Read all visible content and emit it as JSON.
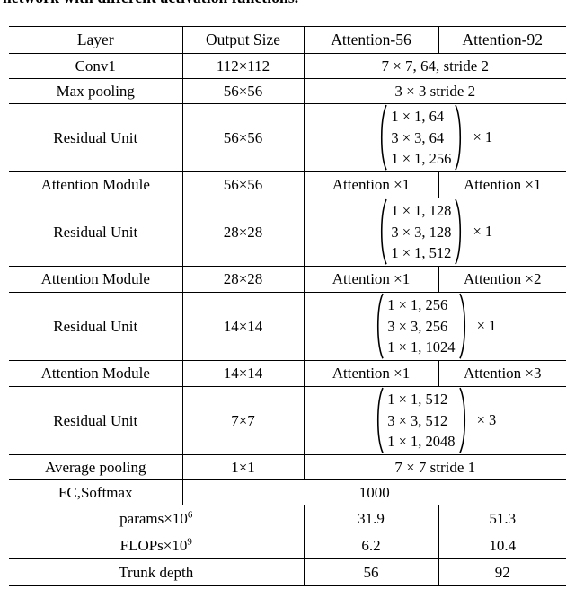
{
  "caption": "network with different activation functions.",
  "table": {
    "headers": [
      "Layer",
      "Output Size",
      "Attention-56",
      "Attention-92"
    ],
    "rows": [
      {
        "layer": "Conv1",
        "output": "112×112",
        "span": "7 × 7, 64, stride 2"
      },
      {
        "layer": "Max pooling",
        "output": "56×56",
        "span": "3 × 3 stride 2"
      },
      {
        "layer": "Residual Unit",
        "output": "56×56",
        "matrix": [
          "1 × 1, 64",
          "3 × 3, 64",
          "1 × 1, 256"
        ],
        "multiplier": "× 1"
      },
      {
        "layer": "Attention Module",
        "output": "56×56",
        "a56": "Attention ×1",
        "a92": "Attention ×1"
      },
      {
        "layer": "Residual Unit",
        "output": "28×28",
        "matrix": [
          "1 × 1, 128",
          "3 × 3, 128",
          "1 × 1, 512"
        ],
        "multiplier": "× 1"
      },
      {
        "layer": "Attention Module",
        "output": "28×28",
        "a56": "Attention ×1",
        "a92": "Attention ×2"
      },
      {
        "layer": "Residual Unit",
        "output": "14×14",
        "matrix": [
          "1 × 1, 256",
          "3 × 3, 256",
          "1 × 1, 1024"
        ],
        "multiplier": "× 1"
      },
      {
        "layer": "Attention Module",
        "output": "14×14",
        "a56": "Attention ×1",
        "a92": "Attention ×3"
      },
      {
        "layer": "Residual Unit",
        "output": "7×7",
        "matrix": [
          "1 × 1, 512",
          "3 × 3, 512",
          "1 × 1, 2048"
        ],
        "multiplier": "× 3"
      },
      {
        "layer": "Average pooling",
        "output": "1×1",
        "span": "7 × 7 stride 1"
      },
      {
        "layer": "FC,Softmax",
        "span3": "1000"
      }
    ],
    "footer": [
      {
        "label_base": "params×10",
        "label_exp": "6",
        "a56": "31.9",
        "a92": "51.3"
      },
      {
        "label_base": "FLOPs×10",
        "label_exp": "9",
        "a56": "6.2",
        "a92": "10.4"
      },
      {
        "label_base": "Trunk depth",
        "label_exp": "",
        "a56": "56",
        "a92": "92"
      }
    ]
  }
}
